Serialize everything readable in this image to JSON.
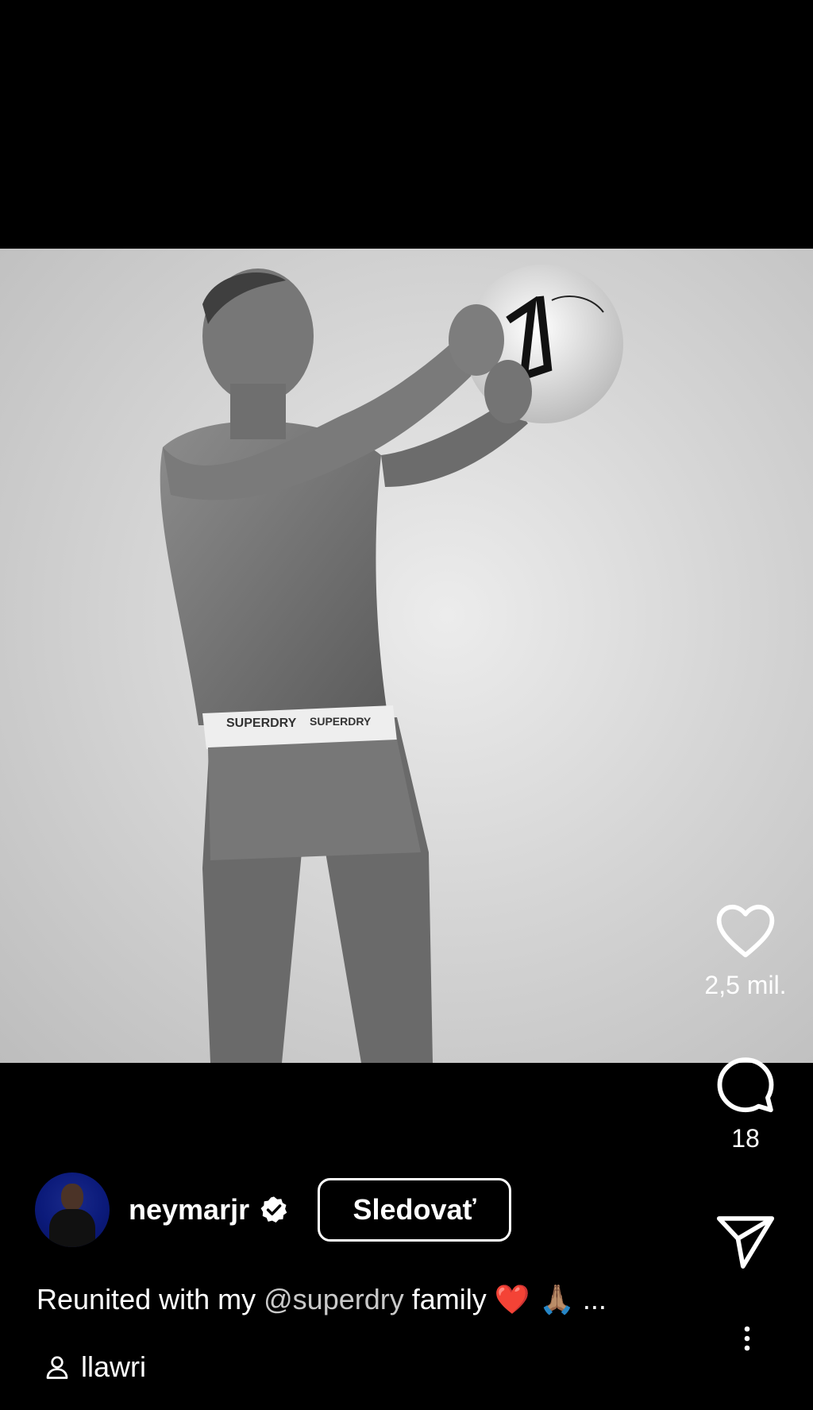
{
  "post": {
    "likes_count": "2,5 mil.",
    "comments_count": "18",
    "username": "neymarjr",
    "follow_label": "Sledovať",
    "caption": {
      "before": "Reunited with my ",
      "mention": "@superdry",
      "after": " family ",
      "emoji": "❤️ 🙏🏽",
      "ellipsis": " ..."
    },
    "audio_user": "llawri",
    "image_brand_text": "SUPERDRY"
  },
  "icons": {
    "like": "heart-icon",
    "comment": "comment-icon",
    "share": "send-icon",
    "more": "more-vertical-icon",
    "verified": "verified-badge-icon",
    "audio": "person-icon"
  },
  "colors": {
    "background": "#000000",
    "text": "#ffffff",
    "mention": "#c9c9c9"
  }
}
